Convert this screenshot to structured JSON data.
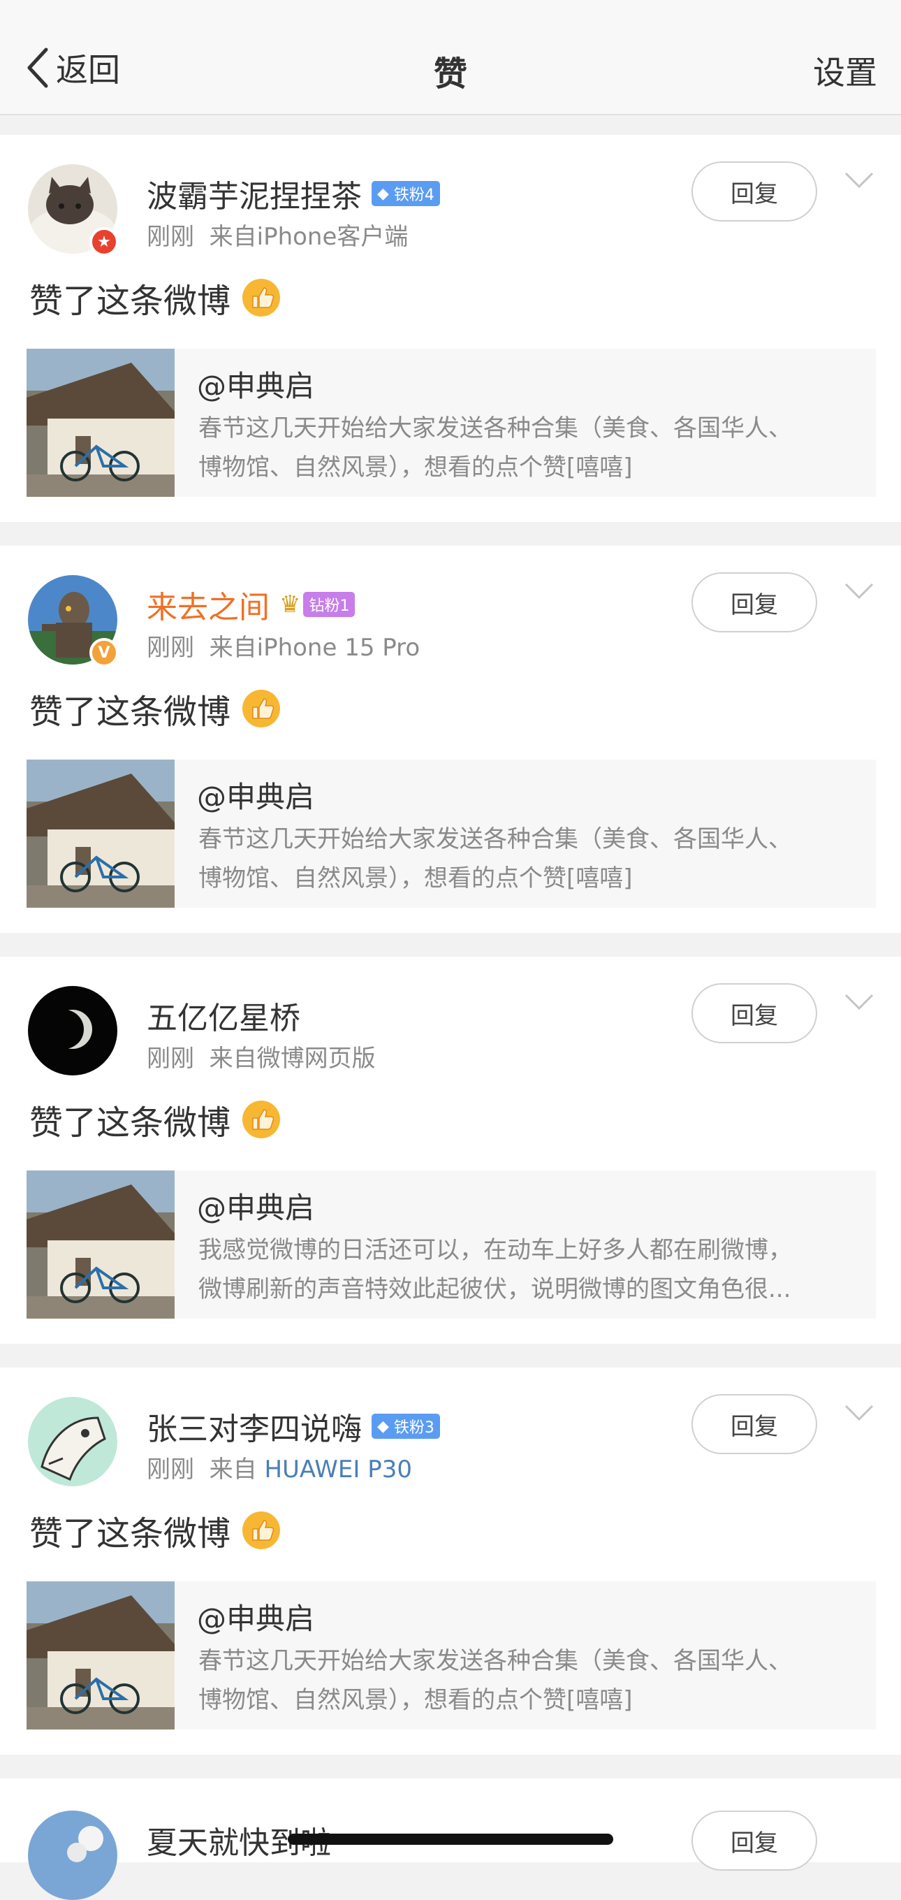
{
  "nav": {
    "back_label": "返回",
    "title": "赞",
    "settings_label": "设置"
  },
  "items": [
    {
      "username": "波霸芋泥捏捏茶",
      "fan_badge": "铁粉4",
      "time": "刚刚",
      "source": "来自iPhone客户端",
      "source_link": "",
      "liked_text": "赞了这条微博",
      "reply_label": "回复",
      "quote": {
        "author": "@申典启",
        "line1": "春节这几天开始给大家发送各种合集（美食、各国华人、",
        "line2": "博物馆、自然风景），想看的点个赞[嘻嘻]"
      }
    },
    {
      "username": "来去之间",
      "fan_badge": "钻粉1",
      "time": "刚刚",
      "source": "来自iPhone 15 Pro",
      "source_link": "",
      "liked_text": "赞了这条微博",
      "reply_label": "回复",
      "quote": {
        "author": "@申典启",
        "line1": "春节这几天开始给大家发送各种合集（美食、各国华人、",
        "line2": "博物馆、自然风景），想看的点个赞[嘻嘻]"
      }
    },
    {
      "username": "五亿亿星桥",
      "fan_badge": "",
      "time": "刚刚",
      "source": "来自微博网页版",
      "source_link": "",
      "liked_text": "赞了这条微博",
      "reply_label": "回复",
      "quote": {
        "author": "@申典启",
        "line1": "我感觉微博的日活还可以，在动车上好多人都在刷微博，",
        "line2": "微博刷新的声音特效此起彼伏，说明微博的图文角色很..."
      }
    },
    {
      "username": "张三对李四说嗨",
      "fan_badge": "铁粉3",
      "time": "刚刚",
      "source": "来自",
      "source_link": "HUAWEI P30",
      "liked_text": "赞了这条微博",
      "reply_label": "回复",
      "quote": {
        "author": "@申典启",
        "line1": "春节这几天开始给大家发送各种合集（美食、各国华人、",
        "line2": "博物馆、自然风景），想看的点个赞[嘻嘻]"
      }
    },
    {
      "username": "夏天就快到啦",
      "reply_label": "回复"
    }
  ],
  "colors": {
    "orange_name": "#f07025",
    "link_blue": "#4a7fb6",
    "iron_badge": "#5a9cf2",
    "diamond_badge": "#c77ee8"
  }
}
